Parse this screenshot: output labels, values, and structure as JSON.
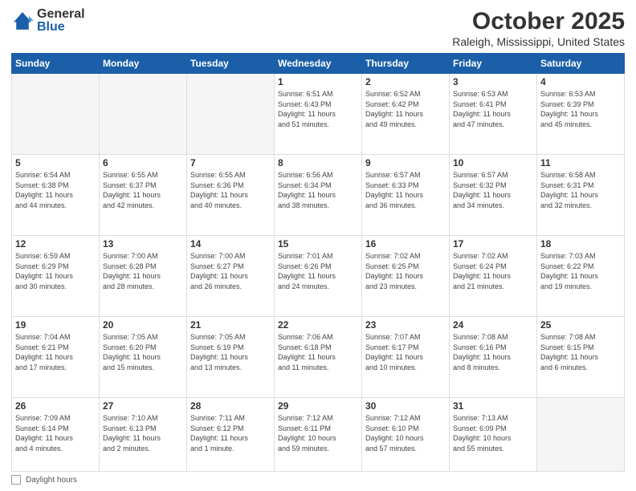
{
  "header": {
    "logo_general": "General",
    "logo_blue": "Blue",
    "month": "October 2025",
    "location": "Raleigh, Mississippi, United States"
  },
  "weekdays": [
    "Sunday",
    "Monday",
    "Tuesday",
    "Wednesday",
    "Thursday",
    "Friday",
    "Saturday"
  ],
  "footer": {
    "label": "Daylight hours"
  },
  "days": {
    "1": {
      "sunrise": "6:51 AM",
      "sunset": "6:43 PM",
      "daylight": "11 hours and 51 minutes."
    },
    "2": {
      "sunrise": "6:52 AM",
      "sunset": "6:42 PM",
      "daylight": "11 hours and 49 minutes."
    },
    "3": {
      "sunrise": "6:53 AM",
      "sunset": "6:41 PM",
      "daylight": "11 hours and 47 minutes."
    },
    "4": {
      "sunrise": "6:53 AM",
      "sunset": "6:39 PM",
      "daylight": "11 hours and 45 minutes."
    },
    "5": {
      "sunrise": "6:54 AM",
      "sunset": "6:38 PM",
      "daylight": "11 hours and 44 minutes."
    },
    "6": {
      "sunrise": "6:55 AM",
      "sunset": "6:37 PM",
      "daylight": "11 hours and 42 minutes."
    },
    "7": {
      "sunrise": "6:55 AM",
      "sunset": "6:36 PM",
      "daylight": "11 hours and 40 minutes."
    },
    "8": {
      "sunrise": "6:56 AM",
      "sunset": "6:34 PM",
      "daylight": "11 hours and 38 minutes."
    },
    "9": {
      "sunrise": "6:57 AM",
      "sunset": "6:33 PM",
      "daylight": "11 hours and 36 minutes."
    },
    "10": {
      "sunrise": "6:57 AM",
      "sunset": "6:32 PM",
      "daylight": "11 hours and 34 minutes."
    },
    "11": {
      "sunrise": "6:58 AM",
      "sunset": "6:31 PM",
      "daylight": "11 hours and 32 minutes."
    },
    "12": {
      "sunrise": "6:59 AM",
      "sunset": "6:29 PM",
      "daylight": "11 hours and 30 minutes."
    },
    "13": {
      "sunrise": "7:00 AM",
      "sunset": "6:28 PM",
      "daylight": "11 hours and 28 minutes."
    },
    "14": {
      "sunrise": "7:00 AM",
      "sunset": "6:27 PM",
      "daylight": "11 hours and 26 minutes."
    },
    "15": {
      "sunrise": "7:01 AM",
      "sunset": "6:26 PM",
      "daylight": "11 hours and 24 minutes."
    },
    "16": {
      "sunrise": "7:02 AM",
      "sunset": "6:25 PM",
      "daylight": "11 hours and 23 minutes."
    },
    "17": {
      "sunrise": "7:02 AM",
      "sunset": "6:24 PM",
      "daylight": "11 hours and 21 minutes."
    },
    "18": {
      "sunrise": "7:03 AM",
      "sunset": "6:22 PM",
      "daylight": "11 hours and 19 minutes."
    },
    "19": {
      "sunrise": "7:04 AM",
      "sunset": "6:21 PM",
      "daylight": "11 hours and 17 minutes."
    },
    "20": {
      "sunrise": "7:05 AM",
      "sunset": "6:20 PM",
      "daylight": "11 hours and 15 minutes."
    },
    "21": {
      "sunrise": "7:05 AM",
      "sunset": "6:19 PM",
      "daylight": "11 hours and 13 minutes."
    },
    "22": {
      "sunrise": "7:06 AM",
      "sunset": "6:18 PM",
      "daylight": "11 hours and 11 minutes."
    },
    "23": {
      "sunrise": "7:07 AM",
      "sunset": "6:17 PM",
      "daylight": "11 hours and 10 minutes."
    },
    "24": {
      "sunrise": "7:08 AM",
      "sunset": "6:16 PM",
      "daylight": "11 hours and 8 minutes."
    },
    "25": {
      "sunrise": "7:08 AM",
      "sunset": "6:15 PM",
      "daylight": "11 hours and 6 minutes."
    },
    "26": {
      "sunrise": "7:09 AM",
      "sunset": "6:14 PM",
      "daylight": "11 hours and 4 minutes."
    },
    "27": {
      "sunrise": "7:10 AM",
      "sunset": "6:13 PM",
      "daylight": "11 hours and 2 minutes."
    },
    "28": {
      "sunrise": "7:11 AM",
      "sunset": "6:12 PM",
      "daylight": "11 hours and 1 minute."
    },
    "29": {
      "sunrise": "7:12 AM",
      "sunset": "6:11 PM",
      "daylight": "10 hours and 59 minutes."
    },
    "30": {
      "sunrise": "7:12 AM",
      "sunset": "6:10 PM",
      "daylight": "10 hours and 57 minutes."
    },
    "31": {
      "sunrise": "7:13 AM",
      "sunset": "6:09 PM",
      "daylight": "10 hours and 55 minutes."
    }
  }
}
